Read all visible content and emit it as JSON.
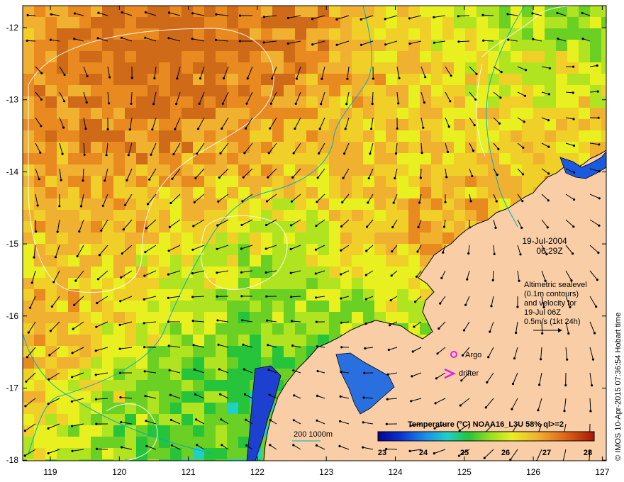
{
  "map": {
    "lat_labels": [
      "-12",
      "-13",
      "-14",
      "-15",
      "-16",
      "-17",
      "-18"
    ],
    "lon_labels": [
      "119",
      "120",
      "121",
      "122",
      "123",
      "124",
      "125",
      "126",
      "127"
    ],
    "date": "19-Jul-2004",
    "time": "06:29Z",
    "info_lines": [
      "Altimetric sealevel",
      "(0.1m contours)",
      "and velocity for",
      "19-Jul 06Z",
      "0.5m/s (1kt 24h)"
    ],
    "legend": {
      "argo": "Argo",
      "drifter": "drifter",
      "bathy": "200  1000m"
    },
    "colorbar": {
      "title": "Temperature (°C) NOAA16_L3U 58% ql>=2",
      "ticks": [
        "23",
        "24",
        "25",
        "26",
        "27",
        "28"
      ]
    },
    "credit": "© IMOS 10-Apr-2015 07:36:54 Hobart time",
    "colors": {
      "land": "#F9CEA6",
      "argo": "#E61EE6",
      "drifter": "#E61EE6",
      "bathy": "#00B0C0"
    }
  }
}
